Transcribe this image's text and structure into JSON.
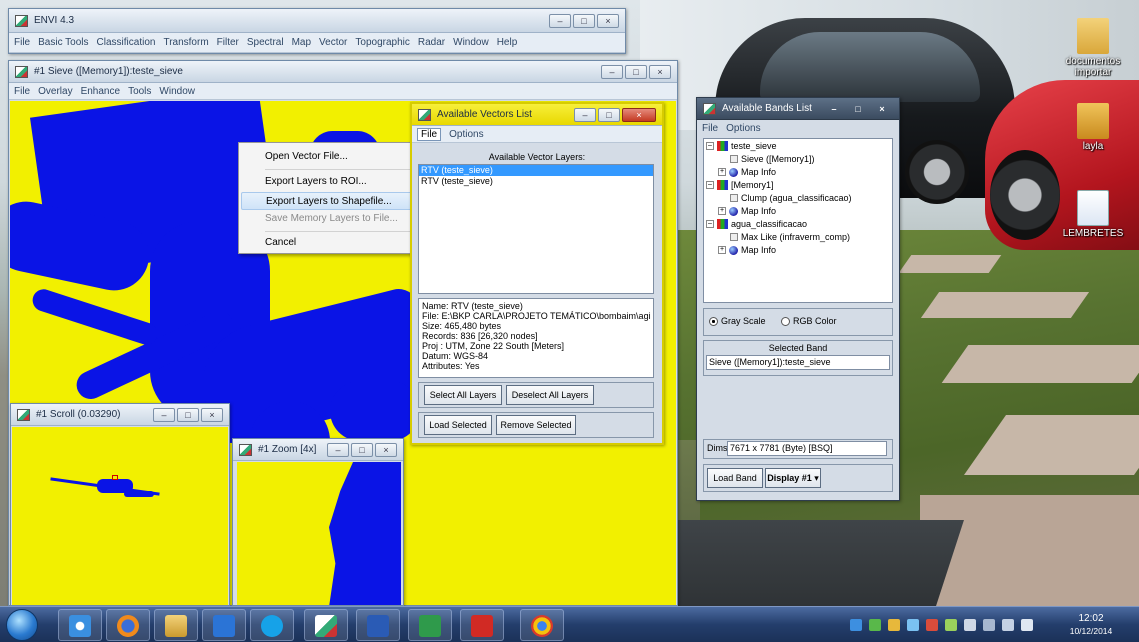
{
  "envi_main": {
    "title": "ENVI 4.3",
    "menu": [
      "File",
      "Basic Tools",
      "Classification",
      "Transform",
      "Filter",
      "Spectral",
      "Map",
      "Vector",
      "Topographic",
      "Radar",
      "Window",
      "Help"
    ]
  },
  "sieve_window": {
    "title": "#1 Sieve ([Memory1]):teste_sieve",
    "menu": [
      "File",
      "Overlay",
      "Enhance",
      "Tools",
      "Window"
    ]
  },
  "context_menu": {
    "items": [
      {
        "label": "Open Vector File...",
        "state": "normal"
      },
      {
        "label": "Export Layers to ROI...",
        "state": "normal"
      },
      {
        "label": "Export Layers to Shapefile...",
        "state": "highlighted"
      },
      {
        "label": "Save Memory Layers to File...",
        "state": "disabled"
      },
      {
        "label": "Cancel",
        "state": "normal"
      }
    ]
  },
  "vectors_list": {
    "title": "Available Vectors List",
    "menu": [
      "File",
      "Options"
    ],
    "heading": "Available Vector Layers:",
    "layers": [
      "RTV (teste_sieve)",
      "RTV (teste_sieve)"
    ],
    "info_lines": [
      "Name: RTV (teste_sieve)",
      "File: E:\\BKP CARLA\\PROJETO TEMÁTICO\\bombaim\\agi",
      "Size: 465,480 bytes",
      "Records: 836 [26,320 nodes]",
      "Proj : UTM, Zone 22 South [Meters]",
      "Datum: WGS-84",
      "Attributes: Yes"
    ],
    "select_all_label": "Select All Layers",
    "deselect_all_label": "Deselect All Layers",
    "load_selected_label": "Load Selected",
    "remove_selected_label": "Remove Selected"
  },
  "bands_list": {
    "title": "Available Bands List",
    "menu": [
      "File",
      "Options"
    ],
    "tree": [
      {
        "level": 0,
        "label": "teste_sieve",
        "icon": "multiband-icon"
      },
      {
        "level": 1,
        "label": "Sieve ([Memory1])",
        "icon": "band-icon"
      },
      {
        "level": 1,
        "label": "Map Info",
        "icon": "globe-icon"
      },
      {
        "level": 0,
        "label": "[Memory1]",
        "icon": "multiband-icon"
      },
      {
        "level": 1,
        "label": "Clump (agua_classificacao)",
        "icon": "band-icon"
      },
      {
        "level": 1,
        "label": "Map Info",
        "icon": "globe-icon"
      },
      {
        "level": 0,
        "label": "agua_classificacao",
        "icon": "multiband-icon"
      },
      {
        "level": 1,
        "label": "Max Like (infraverm_comp)",
        "icon": "band-icon"
      },
      {
        "level": 1,
        "label": "Map Info",
        "icon": "globe-icon"
      }
    ],
    "gray_scale_label": "Gray Scale",
    "rgb_color_label": "RGB Color",
    "selected_band_heading": "Selected Band",
    "selected_band_value": "Sieve ([Memory1]):teste_sieve",
    "dims_label": "Dims",
    "dims_value": "7671 x 7781 (Byte) [BSQ]",
    "load_band_label": "Load Band",
    "display_label": "Display #1"
  },
  "scroll_window": {
    "title": "#1 Scroll (0.03290)"
  },
  "zoom_window": {
    "title": "#1 Zoom [4x]"
  },
  "desktop_icons": [
    {
      "label": "documentos importar",
      "icon": "folder-icon"
    },
    {
      "label": "layla",
      "icon": "powerpoint-folder-icon"
    },
    {
      "label": "LEMBRETES",
      "icon": "word-document-icon"
    }
  ],
  "taskbar": {
    "time": "12:02",
    "date": "10/12/2014"
  },
  "colors": {
    "image_yellow": "#f2f000",
    "image_blue": "#0a14e6",
    "selection_blue": "#3399ff"
  }
}
